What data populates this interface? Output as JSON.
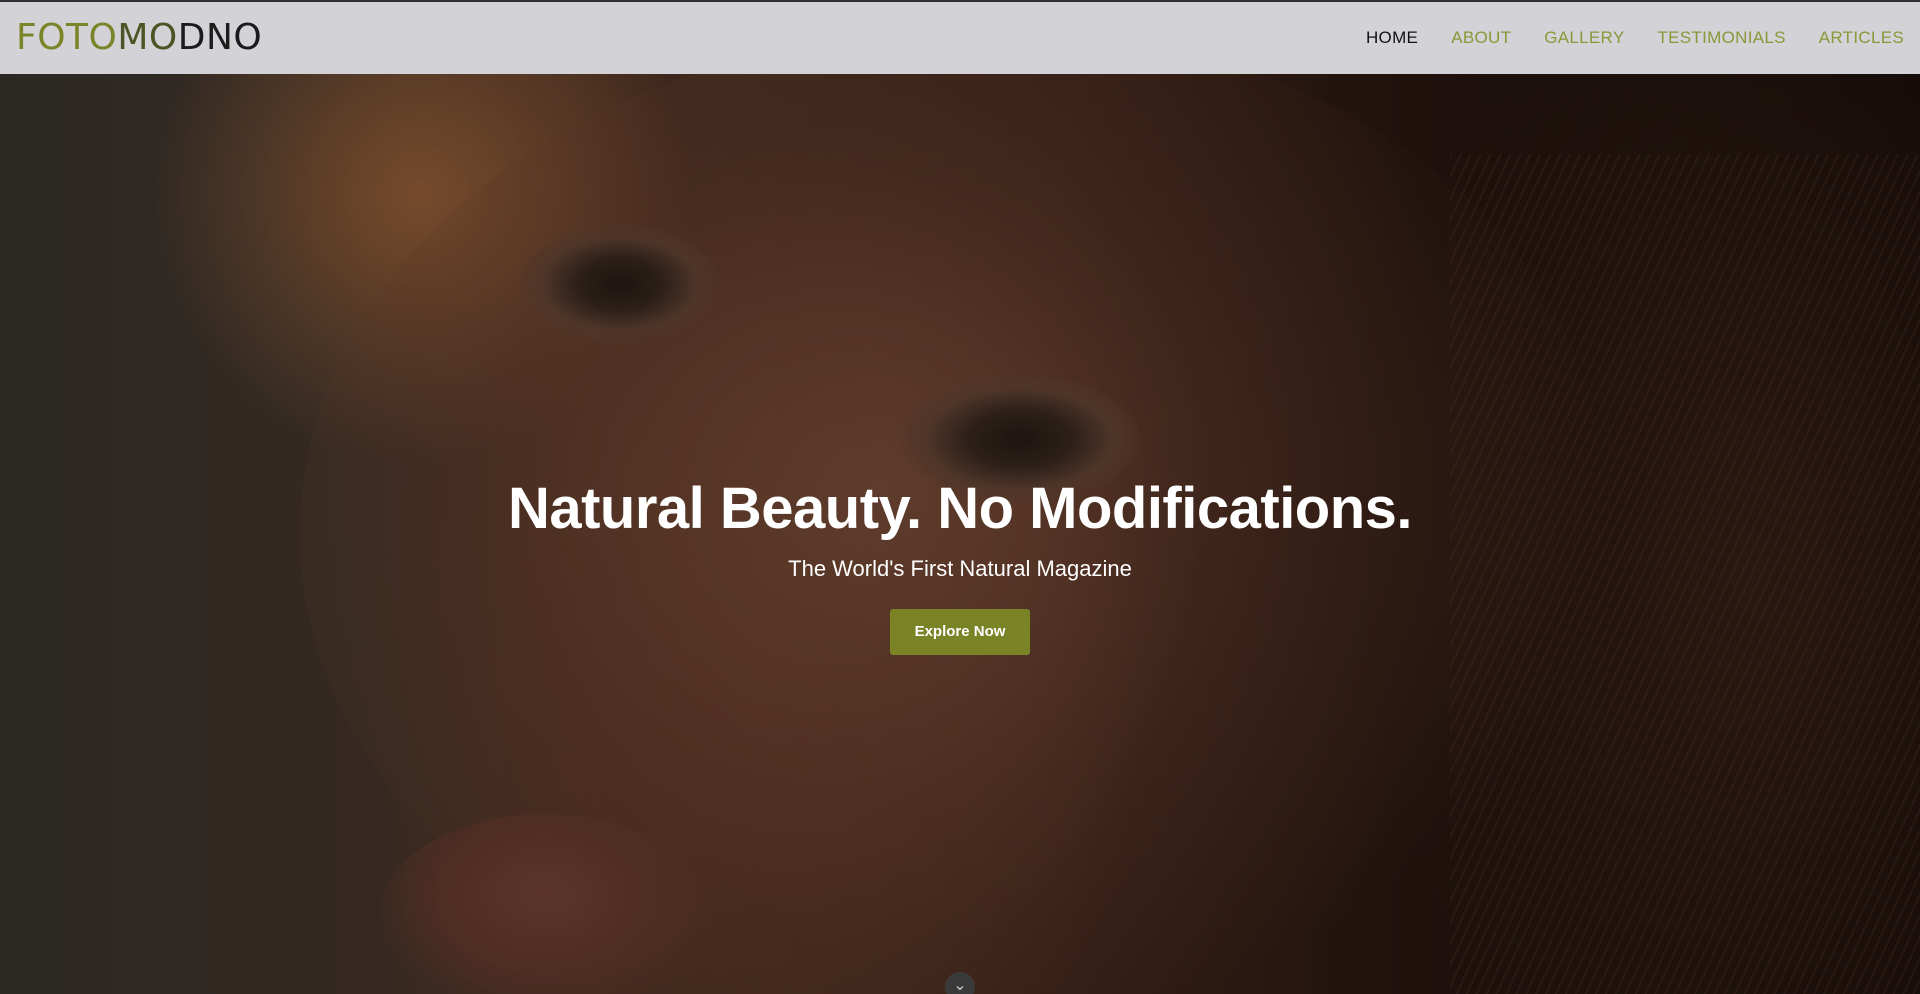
{
  "brand": {
    "part1": "FOTO",
    "part2": "MO",
    "part3": "DNO"
  },
  "nav": {
    "items": [
      {
        "label": "HOME",
        "active": true
      },
      {
        "label": "ABOUT"
      },
      {
        "label": "GALLERY"
      },
      {
        "label": "TESTIMONIALS"
      },
      {
        "label": "ARTICLES"
      }
    ]
  },
  "hero": {
    "title": "Natural Beauty. No Modifications.",
    "subtitle": "The World's First Natural Magazine",
    "cta_label": "Explore Now",
    "scroll_icon": "chevron-down-icon"
  },
  "colors": {
    "accent": "#7a8426",
    "nav_link": "#8b9738",
    "nav_active": "#111111",
    "navbar_bg": "#d3d2d7"
  }
}
